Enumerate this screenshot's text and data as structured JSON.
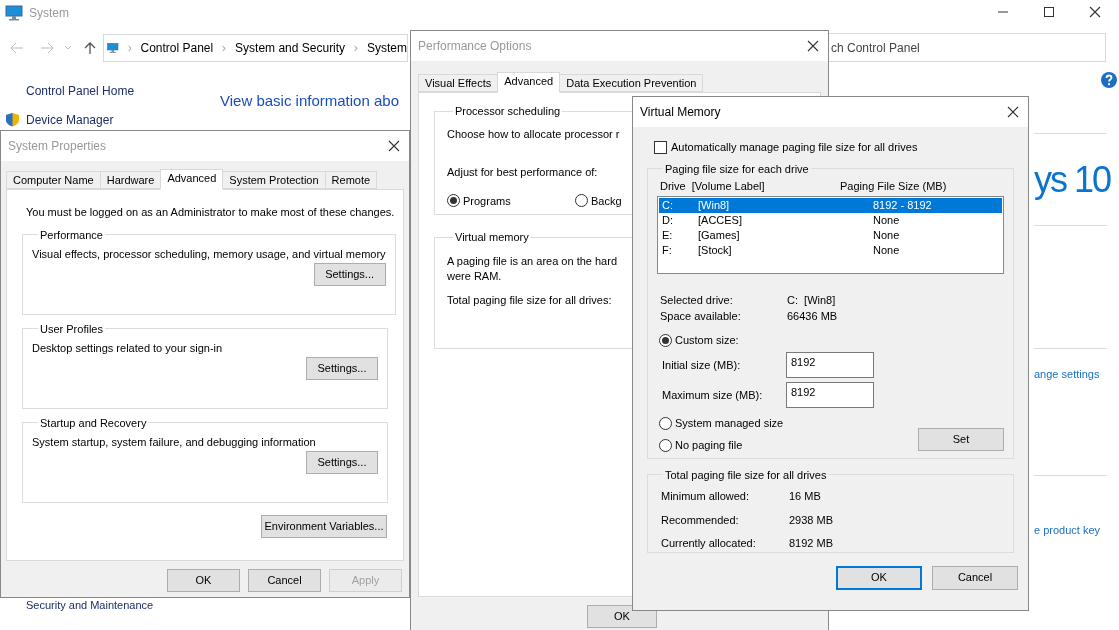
{
  "system_window": {
    "title": "System",
    "breadcrumb": [
      "Control Panel",
      "System and Security",
      "System"
    ],
    "search": {
      "placeholder": "ch Control Panel"
    },
    "sidebar": {
      "items": [
        {
          "label": "Control Panel Home",
          "kind": "home"
        },
        {
          "label": "Device Manager",
          "kind": "shield"
        }
      ]
    },
    "heading": "View basic information abo",
    "logo_text": "ys 10",
    "links": [
      "ange settings",
      "e product key"
    ],
    "see_also": [
      "Security and Maintenance"
    ]
  },
  "system_properties": {
    "title": "System Properties",
    "tabs": [
      {
        "label": "Computer Name",
        "selected": false
      },
      {
        "label": "Hardware",
        "selected": false
      },
      {
        "label": "Advanced",
        "selected": true
      },
      {
        "label": "System Protection",
        "selected": false
      },
      {
        "label": "Remote",
        "selected": false
      }
    ],
    "notice": "You must be logged on as an Administrator to make most of these changes.",
    "groups": [
      {
        "title": "Performance",
        "description": "Visual effects, processor scheduling, memory usage, and virtual memory",
        "button": "Settings..."
      },
      {
        "title": "User Profiles",
        "description": "Desktop settings related to your sign-in",
        "button": "Settings..."
      },
      {
        "title": "Startup and Recovery",
        "description": "System startup, system failure, and debugging information",
        "button": "Settings..."
      }
    ],
    "env_button": "Environment Variables...",
    "buttons": [
      {
        "label": "OK",
        "disabled": false
      },
      {
        "label": "Cancel",
        "disabled": false
      },
      {
        "label": "Apply",
        "disabled": true
      }
    ]
  },
  "performance_options": {
    "title": "Performance Options",
    "tabs": [
      {
        "label": "Visual Effects",
        "selected": false
      },
      {
        "label": "Advanced",
        "selected": true
      },
      {
        "label": "Data Execution Prevention",
        "selected": false
      }
    ],
    "processor_scheduling": {
      "title": "Processor scheduling",
      "description": "Choose how to allocate processor r",
      "adjust_label": "Adjust for best performance of:",
      "options": [
        {
          "label": "Programs",
          "selected": true
        },
        {
          "label": "Backg",
          "selected": false
        }
      ]
    },
    "virtual_memory": {
      "title": "Virtual memory",
      "description_lines": [
        "A paging file is an area on the hard",
        "were RAM."
      ],
      "total_label": "Total paging file size for all drives:"
    },
    "buttons": [
      "OK"
    ]
  },
  "virtual_memory": {
    "title": "Virtual Memory",
    "auto_manage": {
      "label": "Automatically manage paging file size for all drives",
      "checked": false
    },
    "group_title": "Paging file size for each drive",
    "columns": [
      "Drive  [Volume Label]",
      "Paging File Size (MB)"
    ],
    "drives": [
      {
        "drive": "C:",
        "label": "[Win8]",
        "size": "8192 - 8192",
        "selected": true
      },
      {
        "drive": "D:",
        "label": "[ACCES]",
        "size": "None",
        "selected": false
      },
      {
        "drive": "E:",
        "label": "[Games]",
        "size": "None",
        "selected": false
      },
      {
        "drive": "F:",
        "label": "[Stock]",
        "size": "None",
        "selected": false
      }
    ],
    "info": [
      {
        "label": "Selected drive:",
        "value": "C:  [Win8]"
      },
      {
        "label": "Space available:",
        "value": "66436 MB"
      }
    ],
    "size_options": [
      {
        "label": "Custom size:",
        "selected": true
      },
      {
        "label": "System managed size",
        "selected": false
      },
      {
        "label": "No paging file",
        "selected": false
      }
    ],
    "fields": [
      {
        "label": "Initial size (MB):",
        "value": "8192"
      },
      {
        "label": "Maximum size (MB):",
        "value": "8192"
      }
    ],
    "set_button": "Set",
    "totals": {
      "title": "Total paging file size for all drives",
      "rows": [
        {
          "label": "Minimum allowed:",
          "value": "16 MB"
        },
        {
          "label": "Recommended:",
          "value": "2938 MB"
        },
        {
          "label": "Currently allocated:",
          "value": "8192 MB"
        }
      ]
    },
    "buttons": [
      {
        "label": "OK",
        "default": true
      },
      {
        "label": "Cancel",
        "default": false
      }
    ]
  }
}
